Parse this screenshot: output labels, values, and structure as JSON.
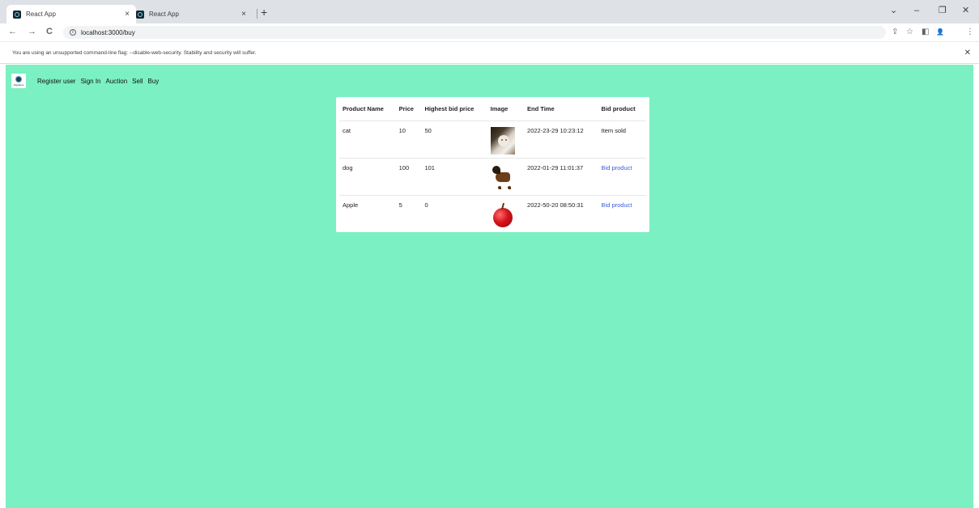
{
  "browser": {
    "tabs": [
      {
        "title": "React App",
        "close": "×"
      },
      {
        "title": "React App",
        "close": "×"
      }
    ],
    "new_tab": "+",
    "window_controls": {
      "tab_search": "⌄",
      "minimize": "–",
      "restore": "❐",
      "close": "✕"
    },
    "nav": {
      "back": "←",
      "forward": "→",
      "reload": "C"
    },
    "address": "localhost:3000/buy",
    "info_icon": "i",
    "toolbar_icons": {
      "share": "⇪",
      "bookmark": "☆",
      "sidepanel": "◧",
      "profile": "👤",
      "menu": "⋮"
    },
    "infobar": {
      "message": "You are using an unsupported command-line flag: --disable-web-security. Stability and security will suffer.",
      "close": "✕"
    }
  },
  "navbar": {
    "logo_text": "Digitalent",
    "links": [
      "Register user",
      "Sign In",
      "Auction",
      "Sell",
      "Buy"
    ]
  },
  "table": {
    "headers": [
      "Product Name",
      "Price",
      "Highest bid price",
      "Image",
      "End Time",
      "Bid product"
    ],
    "rows": [
      {
        "name": "cat",
        "price": "10",
        "highest_bid": "50",
        "image": "cat-photo",
        "end_time": "2022-23-29 10:23:12",
        "bid": "Item sold",
        "bid_is_link": false
      },
      {
        "name": "dog",
        "price": "100",
        "highest_bid": "101",
        "image": "dog-photo",
        "end_time": "2022-01-29 11:01:37",
        "bid": "Bid product",
        "bid_is_link": true
      },
      {
        "name": "Apple",
        "price": "5",
        "highest_bid": "0",
        "image": "apple-photo",
        "end_time": "2022-50-20 08:50:31",
        "bid": "Bid product",
        "bid_is_link": true
      }
    ]
  },
  "colors": {
    "page_background": "#7af0c3",
    "link": "#3b5bdb",
    "tab_strip": "#dee1e6"
  }
}
